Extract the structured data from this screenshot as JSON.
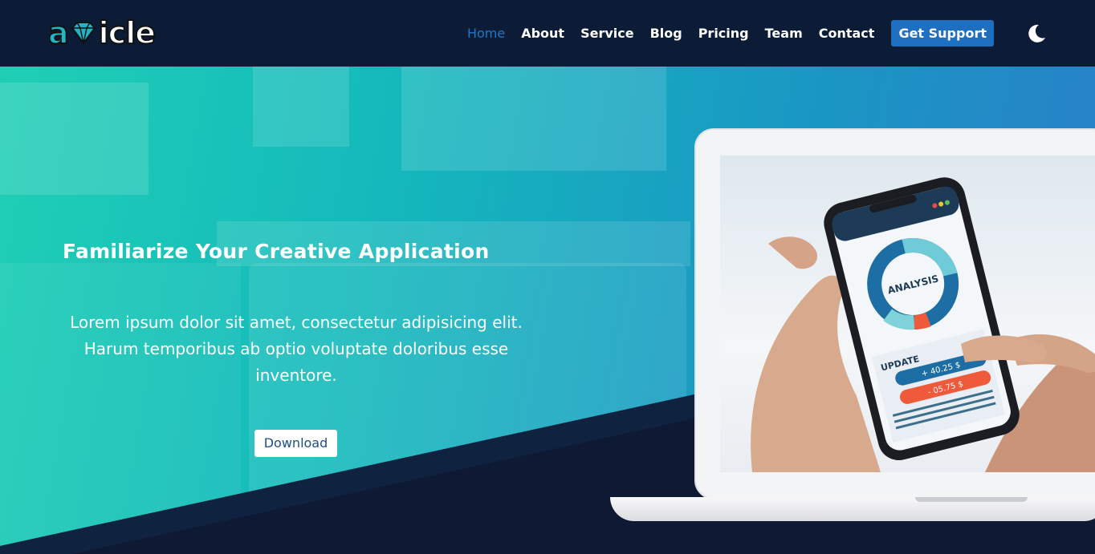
{
  "brand": {
    "logo_text_a": "a",
    "logo_text_rest": "icle",
    "logo_name": "avaicle-logo"
  },
  "nav": {
    "items": [
      {
        "label": "Home",
        "active": true
      },
      {
        "label": "About",
        "active": false
      },
      {
        "label": "Service",
        "active": false
      },
      {
        "label": "Blog",
        "active": false
      },
      {
        "label": "Pricing",
        "active": false
      },
      {
        "label": "Team",
        "active": false
      },
      {
        "label": "Contact",
        "active": false
      }
    ],
    "cta_label": "Get Support",
    "theme_icon": "moon-icon"
  },
  "hero": {
    "title": "Familiarize Your Creative Application",
    "description": "Lorem ipsum dolor sit amet, consectetur adipisicing elit. Harum temporibus ab optio voluptate doloribus esse inventore.",
    "download_label": "Download"
  },
  "phone_screen": {
    "analysis_label": "ANALYSIS",
    "update_label": "UPDATE",
    "positive_value": "+ 40.25 $",
    "negative_value": "- 05.75 $"
  },
  "colors": {
    "nav_bg": "#0c1b36",
    "accent_blue": "#1f6fc0",
    "active_link": "#1f77c9",
    "hero_gradient_start": "#1fcfb5",
    "hero_gradient_end": "#2a7ec8",
    "wedge_dark": "#0e1a33"
  }
}
